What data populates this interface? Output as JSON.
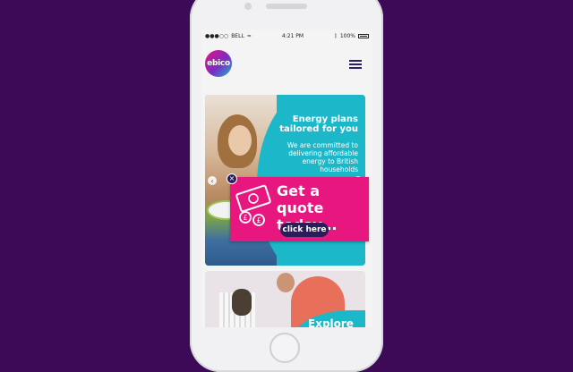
{
  "status_bar": {
    "carrier": "BELL",
    "time": "4:21 PM",
    "battery": "100%"
  },
  "header": {
    "logo_text": "ebico"
  },
  "hero": {
    "title": "Energy plans tailored for you",
    "description": "We are committed to delivering affordable energy to British households"
  },
  "quote_popup": {
    "headline": "Get a quote today...",
    "cta_label": "click here",
    "close_glyph": "×"
  },
  "card2": {
    "title": "Explore"
  },
  "colors": {
    "background": "#3c0a57",
    "teal": "#1cb8c9",
    "pink": "#e8177f",
    "navy": "#2b1d5c"
  }
}
